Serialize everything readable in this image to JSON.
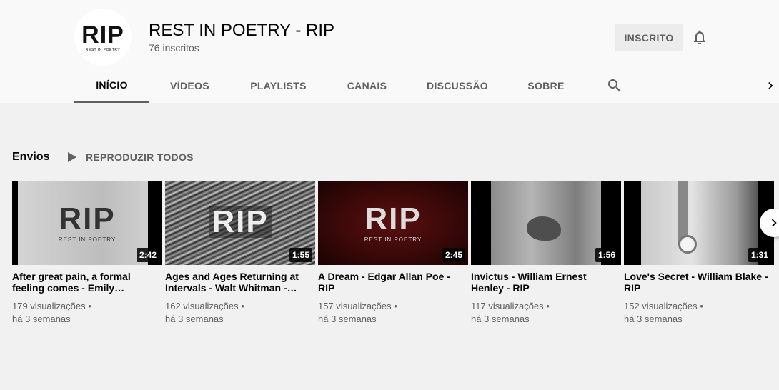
{
  "channel": {
    "title": "REST IN POETRY - RIP",
    "subscribers": "76 inscritos",
    "avatar_logo": "RIP",
    "avatar_sub": "REST IN POETRY",
    "subscribe_label": "INSCRITO"
  },
  "tabs": [
    {
      "label": "INÍCIO",
      "active": true
    },
    {
      "label": "VÍDEOS",
      "active": false
    },
    {
      "label": "PLAYLISTS",
      "active": false
    },
    {
      "label": "CANAIS",
      "active": false
    },
    {
      "label": "DISCUSSÃO",
      "active": false
    },
    {
      "label": "SOBRE",
      "active": false
    }
  ],
  "section": {
    "title": "Envios",
    "play_all": "REPRODUZIR TODOS"
  },
  "videos": [
    {
      "title": "After great pain, a formal feeling comes - Emily…",
      "duration": "2:42",
      "views": "179 visualizações",
      "age": "há 3 semanas",
      "thumb_logo": "RIP",
      "thumb_sub": "REST IN POETRY"
    },
    {
      "title": "Ages and Ages Returning at Intervals - Walt Whitman -…",
      "duration": "1:55",
      "views": "162 visualizações",
      "age": "há 3 semanas",
      "thumb_logo": "RIP",
      "thumb_sub": ""
    },
    {
      "title": "A Dream - Edgar Allan Poe - RIP",
      "duration": "2:45",
      "views": "157 visualizações",
      "age": "há 3 semanas",
      "thumb_logo": "RIP",
      "thumb_sub": "REST IN POETRY"
    },
    {
      "title": "Invictus - William Ernest Henley - RIP",
      "duration": "1:56",
      "views": "117 visualizações",
      "age": "há 3 semanas",
      "thumb_logo": "",
      "thumb_sub": ""
    },
    {
      "title": "Love's Secret - William Blake - RIP",
      "duration": "1:31",
      "views": "152 visualizações",
      "age": "há 3 semanas",
      "thumb_logo": "",
      "thumb_sub": ""
    }
  ],
  "meta_separator": " •",
  "icons": {
    "bell": "bell-icon",
    "search": "search-icon",
    "chevron_right": "chevron-right-icon",
    "play": "play-icon"
  }
}
